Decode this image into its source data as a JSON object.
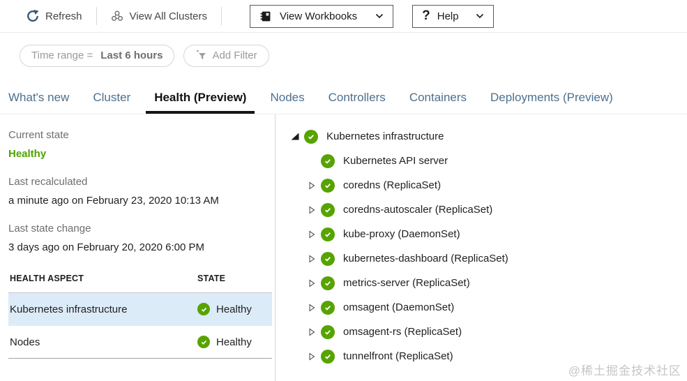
{
  "toolbar": {
    "refresh": "Refresh",
    "view_all_clusters": "View All Clusters",
    "view_workbooks": "View Workbooks",
    "help": "Help",
    "icons": [
      "refresh-icon",
      "clusters-icon",
      "workbook-icon",
      "help-icon",
      "chevron-down-icon"
    ]
  },
  "filters": {
    "time_range_label": "Time range =",
    "time_range_value": "Last 6 hours",
    "add_filter": "Add Filter",
    "add_filter_icon": "add-filter-funnel-icon"
  },
  "tabs": [
    {
      "label": "What's new",
      "active": false
    },
    {
      "label": "Cluster",
      "active": false
    },
    {
      "label": "Health (Preview)",
      "active": true
    },
    {
      "label": "Nodes",
      "active": false
    },
    {
      "label": "Controllers",
      "active": false
    },
    {
      "label": "Containers",
      "active": false
    },
    {
      "label": "Deployments (Preview)",
      "active": false
    }
  ],
  "summary": {
    "current_state_label": "Current state",
    "current_state_value": "Healthy",
    "last_recalculated_label": "Last recalculated",
    "last_recalculated_value": "a minute ago on February 23, 2020 10:13 AM",
    "last_state_change_label": "Last state change",
    "last_state_change_value": "3 days ago on February 20, 2020 6:00 PM"
  },
  "health_table": {
    "columns": [
      "HEALTH ASPECT",
      "STATE"
    ],
    "rows": [
      {
        "aspect": "Kubernetes infrastructure",
        "state": "Healthy",
        "selected": true
      },
      {
        "aspect": "Nodes",
        "state": "Healthy",
        "selected": false
      }
    ]
  },
  "tree": {
    "items": [
      {
        "label": "Kubernetes infrastructure",
        "state": "healthy",
        "expander": "expanded",
        "level": 0
      },
      {
        "label": "Kubernetes API server",
        "state": "healthy",
        "expander": "none",
        "level": 1
      },
      {
        "label": "coredns (ReplicaSet)",
        "state": "healthy",
        "expander": "collapsed",
        "level": 1
      },
      {
        "label": "coredns-autoscaler (ReplicaSet)",
        "state": "healthy",
        "expander": "collapsed",
        "level": 1
      },
      {
        "label": "kube-proxy (DaemonSet)",
        "state": "healthy",
        "expander": "collapsed",
        "level": 1
      },
      {
        "label": "kubernetes-dashboard (ReplicaSet)",
        "state": "healthy",
        "expander": "collapsed",
        "level": 1
      },
      {
        "label": "metrics-server (ReplicaSet)",
        "state": "healthy",
        "expander": "collapsed",
        "level": 1
      },
      {
        "label": "omsagent (DaemonSet)",
        "state": "healthy",
        "expander": "collapsed",
        "level": 1
      },
      {
        "label": "omsagent-rs (ReplicaSet)",
        "state": "healthy",
        "expander": "collapsed",
        "level": 1
      },
      {
        "label": "tunnelfront (ReplicaSet)",
        "state": "healthy",
        "expander": "collapsed",
        "level": 1
      }
    ]
  },
  "colors": {
    "healthy_green": "#57a300",
    "healthy_text_green": "#4ea300",
    "selected_row_bg": "#dcebf8",
    "tab_inactive": "#4c708f",
    "tab_active": "#121212"
  },
  "watermark": "@稀土掘金技术社区"
}
